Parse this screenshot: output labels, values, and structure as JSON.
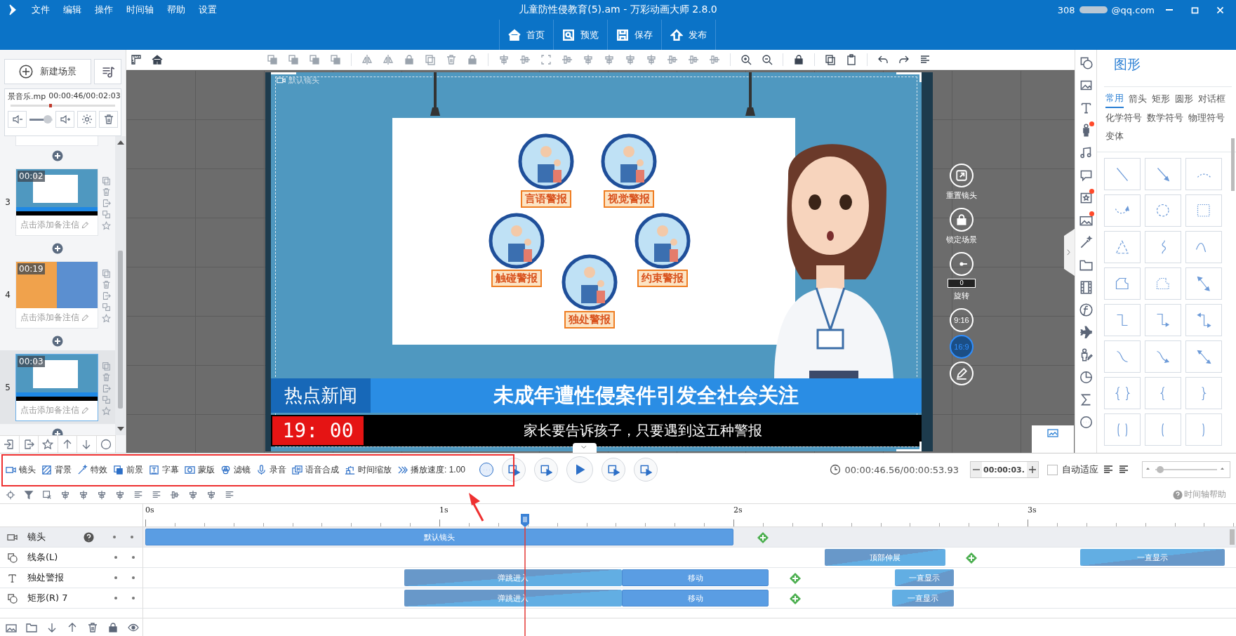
{
  "menu": [
    "文件",
    "编辑",
    "操作",
    "时间轴",
    "帮助",
    "设置"
  ],
  "window": {
    "title": "儿童防性侵教育(5).am - 万彩动画大师 2.8.0"
  },
  "account": {
    "name_visible": "308",
    "domain": "@qq.com"
  },
  "nav": [
    "首页",
    "预览",
    "保存",
    "发布"
  ],
  "left_panel": {
    "new_scene": "新建场景",
    "music": {
      "name": "景音乐.mp",
      "time": "00:00:46/00:02:03",
      "level": 0.38
    },
    "volume": {
      "level": 0.95
    },
    "scenes": [
      {
        "number": "3",
        "time": "00:02",
        "note": "点击添加备注信",
        "kind": "board",
        "selected": false
      },
      {
        "number": "4",
        "time": "00:19",
        "note": "点击添加备注信",
        "kind": "split",
        "selected": false
      },
      {
        "number": "5",
        "time": "00:03",
        "note": "点击添加备注信",
        "kind": "board",
        "selected": true
      }
    ]
  },
  "stage": {
    "camera_label": "默认镜头",
    "alerts": [
      {
        "label": "言语警报"
      },
      {
        "label": "视觉警报"
      },
      {
        "label": "触碰警报"
      },
      {
        "label": "约束警报"
      },
      {
        "label": "独处警报"
      }
    ],
    "news_tag": "热点新闻",
    "headline": "未成年遭性侵案件引发全社会关注",
    "clock": "19: 00",
    "subtitle": "家长要告诉孩子，只要遇到这五种警报"
  },
  "stage_controls": {
    "reset": "重置镜头",
    "lock": "锁定场景",
    "rotation": "0",
    "rotate_label": "旋转",
    "ratios": [
      {
        "label": "9:16",
        "selected": false
      },
      {
        "label": "16:9",
        "selected": true
      }
    ]
  },
  "tool_rail": [
    {
      "dot": false
    },
    {
      "dot": false
    },
    {
      "dot": false
    },
    {
      "dot": true
    },
    {
      "dot": false
    },
    {
      "dot": false
    },
    {
      "dot": true
    },
    {
      "dot": true
    },
    {
      "dot": false
    },
    {
      "dot": false
    },
    {
      "dot": false
    },
    {
      "dot": false
    },
    {
      "dot": false
    },
    {
      "dot": false
    },
    {
      "dot": false
    },
    {
      "dot": false
    },
    {
      "dot": false
    }
  ],
  "shapes_panel": {
    "title": "图形",
    "tabs": [
      {
        "label": "常用",
        "selected": true
      },
      {
        "label": "箭头",
        "selected": false
      },
      {
        "label": "矩形",
        "selected": false
      },
      {
        "label": "圆形",
        "selected": false
      },
      {
        "label": "对话框",
        "selected": false
      },
      {
        "label": "化学符号",
        "selected": false
      },
      {
        "label": "数学符号",
        "selected": false
      },
      {
        "label": "物理符号",
        "selected": false
      },
      {
        "label": "变体",
        "selected": false
      }
    ]
  },
  "timeline_toolbar": {
    "items": [
      "镜头",
      "背景",
      "特效",
      "前景",
      "字幕",
      "蒙版",
      "滤镜",
      "录音",
      "语音合成",
      "时间缩放"
    ],
    "speed": "播放速度: 1.00",
    "clock": "00:00:46.56/00:00:53.93",
    "step": "00:00:03.",
    "auto_fit": {
      "label": "自动适应",
      "checked": false
    },
    "zoom": {
      "level": 0.08
    },
    "help": "时间轴帮助"
  },
  "ruler": [
    "0s",
    "1s",
    "2s",
    "3s"
  ],
  "tracks": [
    {
      "name": "镜头",
      "kind": "camera",
      "selected": true,
      "help": true,
      "clips": [
        {
          "label": "默认镜头",
          "kind": "camera"
        }
      ]
    },
    {
      "name": "线条(L)",
      "kind": "shape",
      "selected": false,
      "help": false,
      "clips": [
        {
          "label": "顶部伸展",
          "kind": "enter"
        },
        {
          "label": "一直显示",
          "kind": "exit"
        }
      ]
    },
    {
      "name": "独处警报",
      "kind": "text",
      "selected": false,
      "help": false,
      "clips": [
        {
          "label": "弹跳进入",
          "kind": "enter"
        },
        {
          "label": "移动",
          "kind": "move"
        },
        {
          "label": "一直显示",
          "kind": "exit"
        }
      ]
    },
    {
      "name": "矩形(R) 7",
      "kind": "shape",
      "selected": false,
      "help": false,
      "clips": [
        {
          "label": "弹跳进入",
          "kind": "enter"
        },
        {
          "label": "移动",
          "kind": "move"
        },
        {
          "label": "一直显示",
          "kind": "exit"
        }
      ]
    }
  ]
}
